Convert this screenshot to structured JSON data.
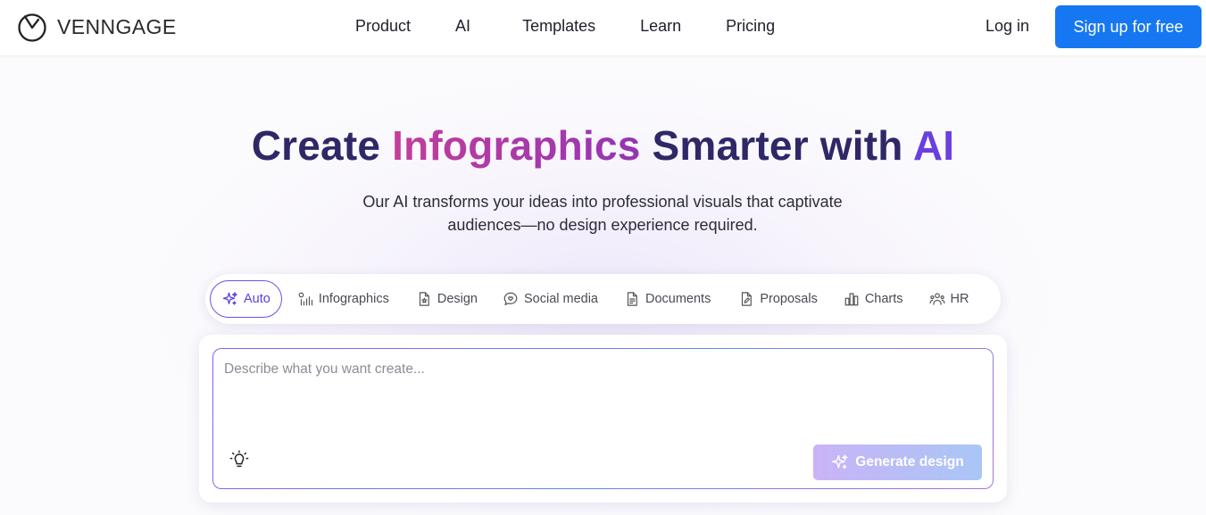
{
  "brand": {
    "name": "VENNGAGE",
    "icon": "venngage-logo-icon"
  },
  "nav": {
    "items": [
      "Product",
      "AI",
      "Templates",
      "Learn",
      "Pricing"
    ],
    "login": "Log in",
    "signup": "Sign up for free"
  },
  "hero": {
    "title_part1": "Create ",
    "title_highlight": "Infographics",
    "title_part2": " Smarter with ",
    "title_ai": "AI",
    "subtitle": "Our AI transforms your ideas into professional visuals that captivate audiences—no design experience required."
  },
  "tabs": [
    {
      "label": "Auto",
      "icon": "sparkle-icon",
      "active": true
    },
    {
      "label": "Infographics",
      "icon": "infographic-bars-icon",
      "active": false
    },
    {
      "label": "Design",
      "icon": "design-file-icon",
      "active": false
    },
    {
      "label": "Social media",
      "icon": "chat-heart-icon",
      "active": false
    },
    {
      "label": "Documents",
      "icon": "document-icon",
      "active": false
    },
    {
      "label": "Proposals",
      "icon": "proposal-pen-icon",
      "active": false
    },
    {
      "label": "Charts",
      "icon": "bar-chart-icon",
      "active": false
    },
    {
      "label": "HR",
      "icon": "people-icon",
      "active": false
    }
  ],
  "prompt": {
    "placeholder": "Describe what you want create...",
    "value": "",
    "idea_icon": "lightbulb-icon",
    "generate_label": "Generate design"
  },
  "colors": {
    "primary_button": "#1677f2",
    "title_dark": "#2f2867",
    "title_highlight_start": "#c23e99",
    "title_highlight_end": "#9335b5",
    "title_ai": "#6a3fe0",
    "active_tab_border": "#6b52e8"
  }
}
